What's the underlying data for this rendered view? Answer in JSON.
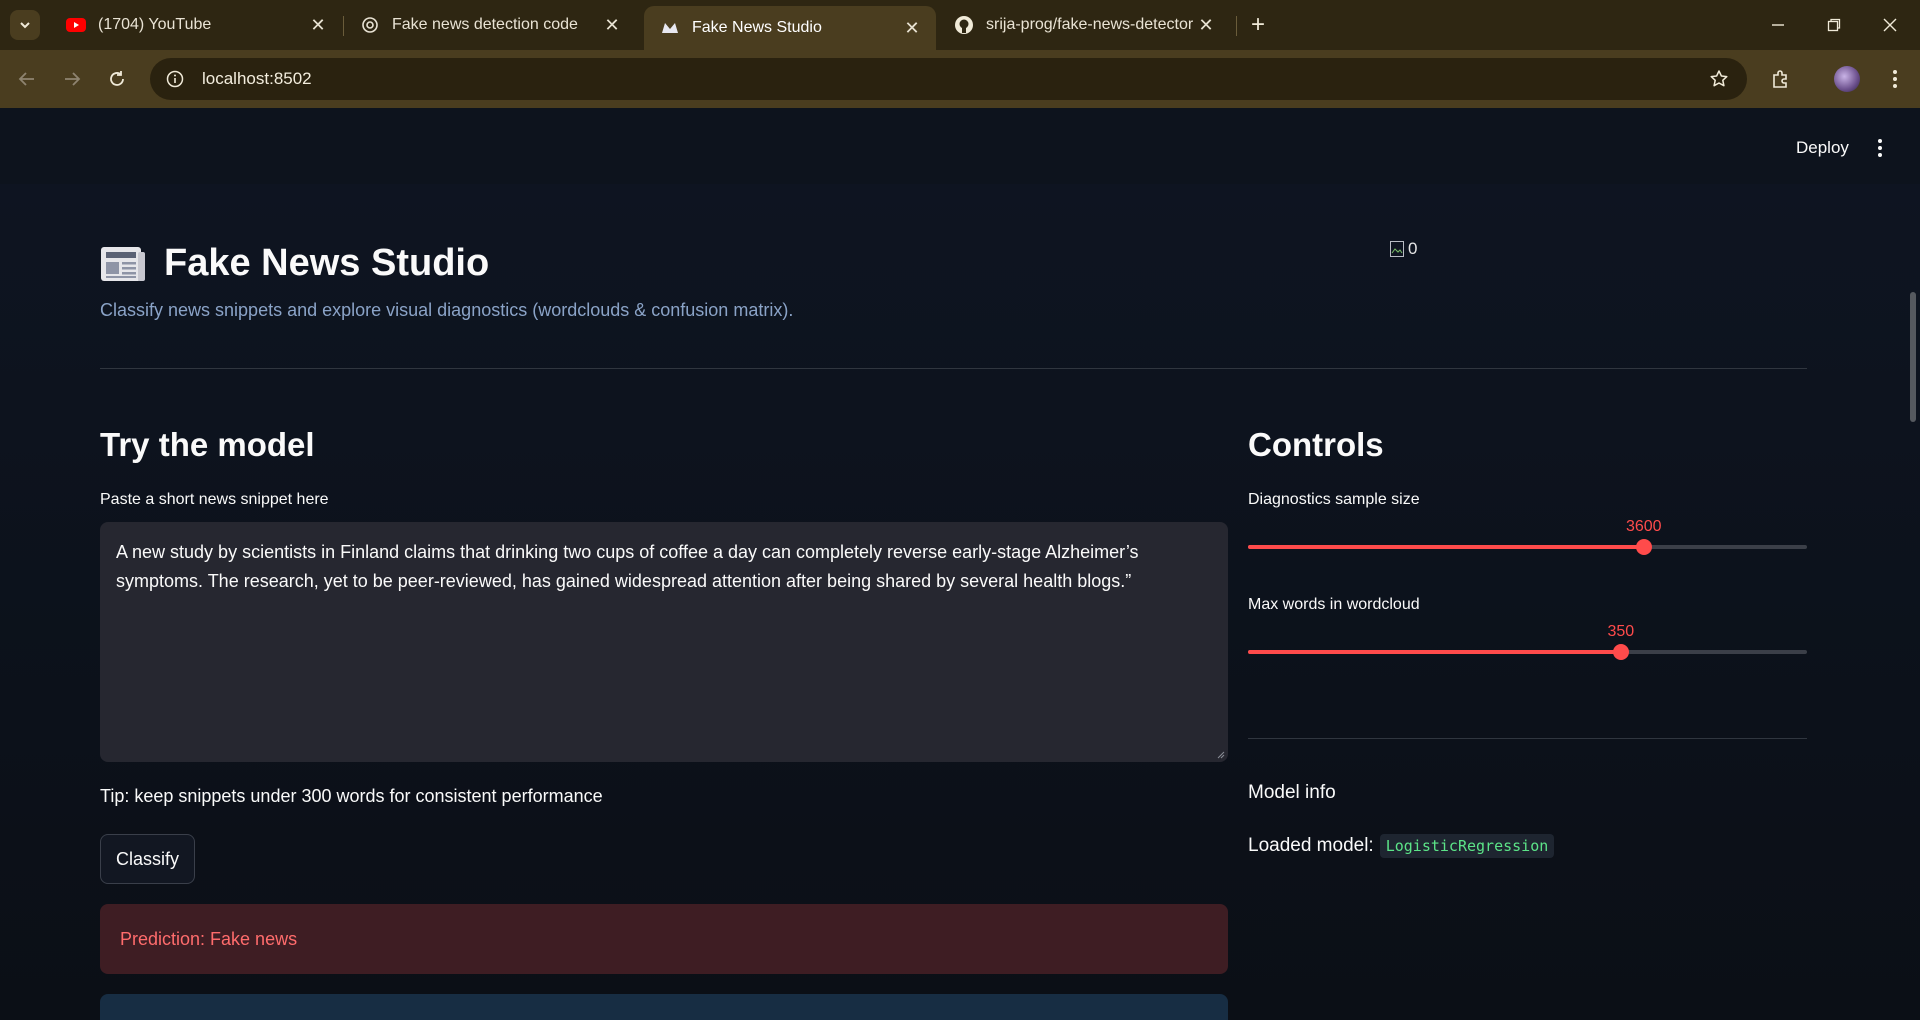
{
  "browser": {
    "tabs": [
      {
        "title": "(1704) YouTube",
        "icon": "youtube-icon"
      },
      {
        "title": "Fake news detection code",
        "icon": "chatgpt-icon"
      },
      {
        "title": "Fake News Studio",
        "icon": "streamlit-icon",
        "active": true
      },
      {
        "title": "srija-prog/fake-news-detector",
        "icon": "github-icon"
      }
    ],
    "url": "localhost:8502"
  },
  "app": {
    "deploy_label": "Deploy",
    "title": "Fake News Studio",
    "title_icon": "newspaper-icon",
    "broken_image_alt": "0",
    "subtitle": "Classify news snippets and explore visual diagnostics (wordclouds & confusion matrix).",
    "left": {
      "heading": "Try the model",
      "input_label": "Paste a short news snippet here",
      "input_value": "A new study by scientists in Finland claims that drinking two cups of coffee a day can completely reverse early-stage Alzheimer’s symptoms. The research, yet to be peer-reviewed, has gained widespread attention after being shared by several health blogs.”",
      "tip": "Tip: keep snippets under 300 words for consistent performance",
      "button_label": "Classify",
      "prediction": "Prediction: Fake news"
    },
    "controls": {
      "heading": "Controls",
      "sample_size": {
        "label": "Diagnostics sample size",
        "value": "3600",
        "fraction": 0.708
      },
      "max_words": {
        "label": "Max words in wordcloud",
        "value": "350",
        "fraction": 0.667
      },
      "model_info": "Model info",
      "loaded_label": "Loaded model:",
      "loaded_model": "LogisticRegression"
    }
  },
  "colors": {
    "accent": "#ff4b4b",
    "background": "#0e1117",
    "chrome": "#4a3d1f",
    "code_green": "#5ce488"
  }
}
